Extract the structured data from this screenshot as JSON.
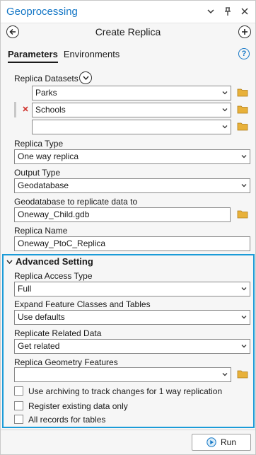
{
  "window": {
    "title": "Geoprocessing",
    "tool_title": "Create Replica"
  },
  "tabs": [
    {
      "label": "Parameters",
      "active": true
    },
    {
      "label": "Environments",
      "active": false
    }
  ],
  "fields": {
    "replica_datasets_label": "Replica Datasets",
    "datasets": [
      "Parks",
      "Schools",
      ""
    ],
    "replica_type_label": "Replica Type",
    "replica_type_value": "One way replica",
    "output_type_label": "Output Type",
    "output_type_value": "Geodatabase",
    "geodatabase_label": "Geodatabase to replicate data to",
    "geodatabase_value": "Oneway_Child.gdb",
    "replica_name_label": "Replica Name",
    "replica_name_value": "Oneway_PtoC_Replica"
  },
  "advanced": {
    "section_title": "Advanced Setting",
    "access_type_label": "Replica Access Type",
    "access_type_value": "Full",
    "expand_label": "Expand Feature Classes and Tables",
    "expand_value": "Use defaults",
    "related_label": "Replicate Related Data",
    "related_value": "Get related",
    "geometry_label": "Replica Geometry Features",
    "geometry_value": "",
    "checkboxes": [
      {
        "label": "Use archiving to track changes for 1 way replication",
        "checked": false
      },
      {
        "label": "Register existing data only",
        "checked": false
      },
      {
        "label": "All records for tables",
        "checked": false
      }
    ]
  },
  "footer": {
    "run_label": "Run"
  },
  "colors": {
    "accent": "#1577c6",
    "highlight_frame": "#1b9bd8",
    "folder": "#e8b13a",
    "remove_x": "#d0332d"
  }
}
